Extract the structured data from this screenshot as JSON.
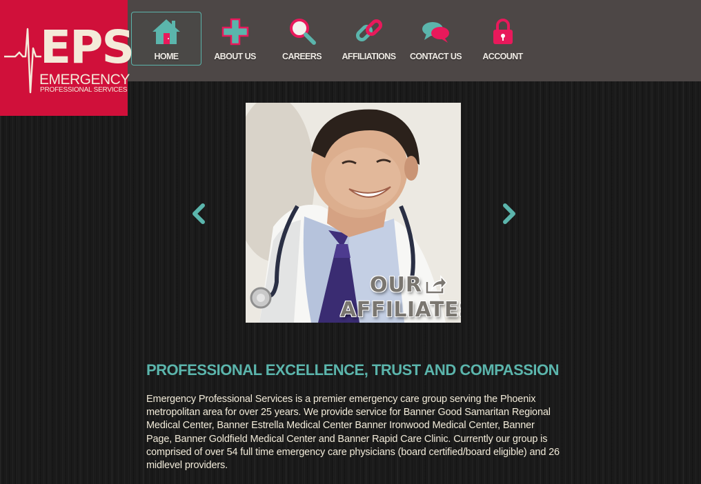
{
  "brand": {
    "logo_letters": "EPS",
    "logo_line1": "EMERGENCY",
    "logo_line2": "PROFESSIONAL SERVICES"
  },
  "nav": {
    "items": [
      {
        "label": "HOME",
        "icon": "house-icon",
        "active": true
      },
      {
        "label": "ABOUT US",
        "icon": "medical-cross-icon",
        "active": false
      },
      {
        "label": "CAREERS",
        "icon": "magnifier-icon",
        "active": false
      },
      {
        "label": "AFFILIATIONS",
        "icon": "chain-link-icon",
        "active": false
      },
      {
        "label": "CONTACT US",
        "icon": "speech-bubbles-icon",
        "active": false
      },
      {
        "label": "ACCOUNT",
        "icon": "padlock-icon",
        "active": false
      }
    ]
  },
  "slider": {
    "prev_icon": "chevron-left-icon",
    "next_icon": "chevron-right-icon",
    "slide": {
      "overlay_line1": "OUR",
      "overlay_line2": "AFFILIATES",
      "overlay_icon": "share-arrow-icon",
      "image": "smiling doctor with stethoscope"
    }
  },
  "content": {
    "heading": "PROFESSIONAL EXCELLENCE, TRUST AND COMPASSION",
    "paragraph": "Emergency Professional Services is a premier emergency care group serving the Phoenix metropolitan area for over 25 years. We provide service for Banner Good Samaritan Regional Medical Center, Banner Estrella Medical Center Banner Ironwood Medical Center, Banner Page, Banner Goldfield Medical Center and Banner Rapid Care Clinic. Currently our group is comprised of over 54 full time emergency care physicians (board certified/board eligible) and 26 midlevel providers."
  },
  "colors": {
    "brand_red": "#d0103a",
    "accent_teal": "#5bb5ac",
    "nav_background": "#4d4746",
    "body_text": "#f2ebd9",
    "icon_pink": "#e8195b"
  }
}
